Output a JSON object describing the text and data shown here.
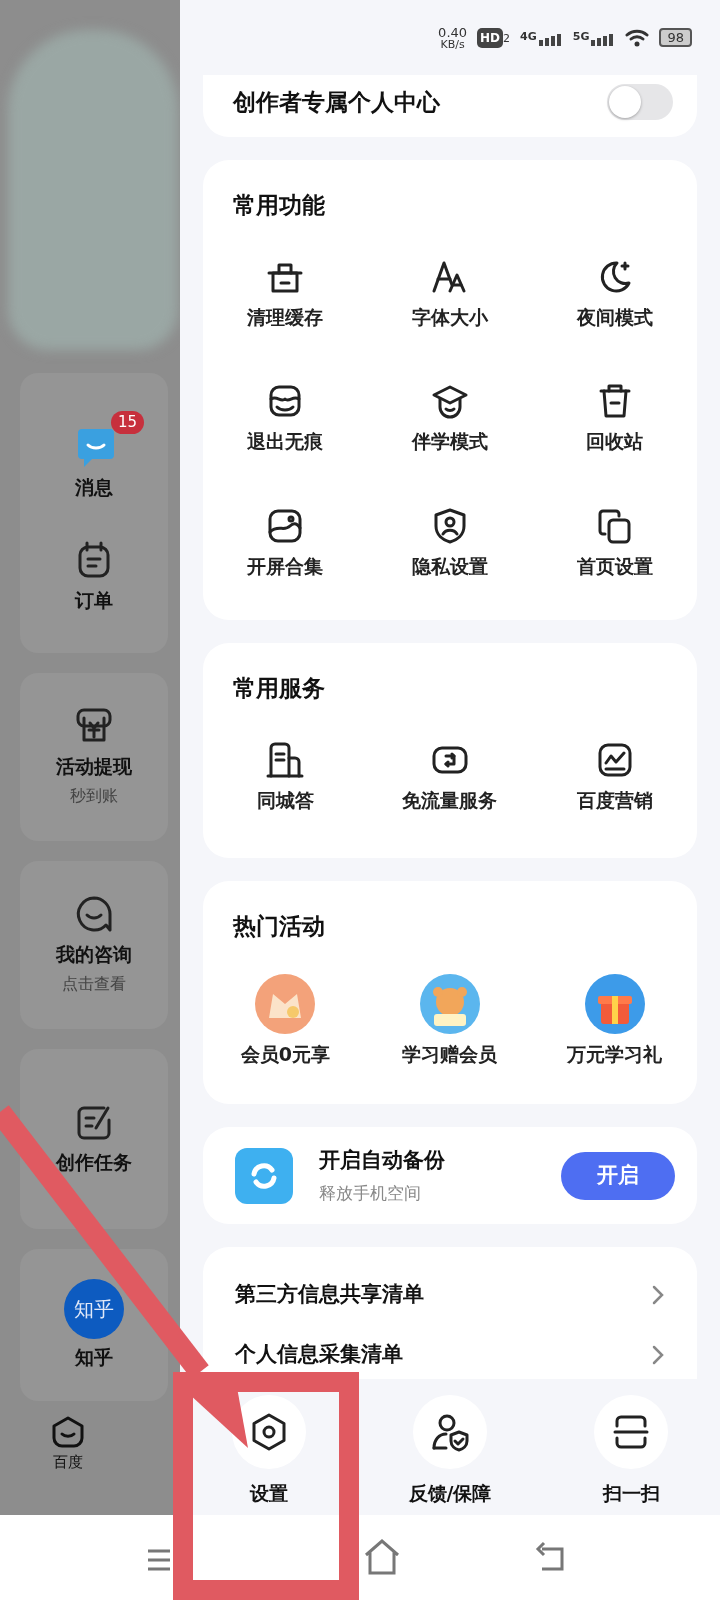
{
  "status_bar": {
    "speed": "0.40",
    "speed_unit": "KB/s",
    "hd": "HD",
    "hd_sim": "2",
    "net_1": "4G",
    "net_2": "5G",
    "battery": "98"
  },
  "left_panel": {
    "items": [
      {
        "label": "消息",
        "badge": "15"
      },
      {
        "label": "订单"
      },
      {
        "label": "活动提现",
        "sub": "秒到账"
      },
      {
        "label": "我的咨询",
        "sub": "点击查看"
      },
      {
        "label": "创作任务"
      },
      {
        "label": "知乎",
        "logo": "知乎"
      }
    ],
    "tab": "百度"
  },
  "creator_toggle": {
    "label": "创作者专属个人中心",
    "on": false
  },
  "sections": [
    {
      "title": "常用功能",
      "items": [
        "清理缓存",
        "字体大小",
        "夜间模式",
        "退出无痕",
        "伴学模式",
        "回收站",
        "开屏合集",
        "隐私设置",
        "首页设置"
      ]
    },
    {
      "title": "常用服务",
      "items": [
        "同城答",
        "免流量服务",
        "百度营销"
      ]
    }
  ],
  "hot_activities": {
    "title": "热门活动",
    "items": [
      "会员0元享",
      "学习赠会员",
      "万元学习礼"
    ]
  },
  "backup": {
    "title": "开启自动备份",
    "subtitle": "释放手机空间",
    "button": "开启"
  },
  "links": [
    "第三方信息共享清单",
    "个人信息采集清单"
  ],
  "bottom_actions": [
    "设置",
    "反馈/保障",
    "扫一扫"
  ]
}
